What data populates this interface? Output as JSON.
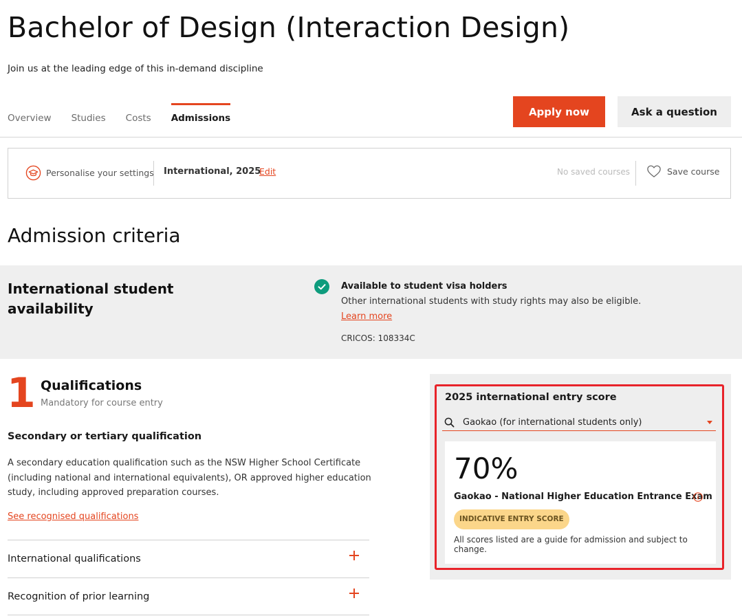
{
  "header": {
    "title": "Bachelor of Design (Interaction Design)",
    "subtitle": "Join us at the leading edge of this in-demand discipline"
  },
  "tabs": [
    {
      "label": "Overview",
      "active": false
    },
    {
      "label": "Studies",
      "active": false
    },
    {
      "label": "Costs",
      "active": false
    },
    {
      "label": "Admissions",
      "active": true
    }
  ],
  "actions": {
    "apply_label": "Apply now",
    "ask_label": "Ask a question"
  },
  "settings": {
    "personalise_label": "Personalise your settings",
    "value": "International, 2025",
    "edit_label": "Edit",
    "no_saved_label": "No saved courses",
    "save_label": "Save course"
  },
  "admission": {
    "title": "Admission criteria",
    "availability": {
      "title": "International student availability",
      "heading": "Available to student visa holders",
      "text": "Other international students with study rights may also be eligible.",
      "learn_more": "Learn more",
      "cricos": "CRICOS: 108334C"
    }
  },
  "qualifications": {
    "step_number": "1",
    "title": "Qualifications",
    "subtitle": "Mandatory for course entry",
    "heading": "Secondary or tertiary qualification",
    "description": "A secondary education qualification such as the NSW Higher School Certificate (including national and international equivalents), OR approved higher education study, including approved preparation courses.",
    "link_label": "See recognised qualifications",
    "accordions": [
      {
        "label": "International qualifications"
      },
      {
        "label": "Recognition of prior learning"
      }
    ]
  },
  "entry_score": {
    "heading": "2025 international entry score",
    "selected_exam": "Gaokao (for international students only)",
    "value": "70%",
    "exam_name": "Gaokao - National Higher Education Entrance Exam",
    "badge": "INDICATIVE ENTRY SCORE",
    "note": "All scores listed are a guide for admission and subject to change."
  },
  "colors": {
    "accent": "#e4451f",
    "success": "#0e9c7d",
    "badge_bg": "#fbd68a",
    "highlight_border": "#e8232a"
  },
  "icons": {
    "personalise": "graduation-cap-icon",
    "save": "heart-icon",
    "availability": "check-circle-icon",
    "search": "search-icon",
    "dropdown": "caret-down-icon",
    "info": "info-icon",
    "expand": "plus-icon"
  }
}
